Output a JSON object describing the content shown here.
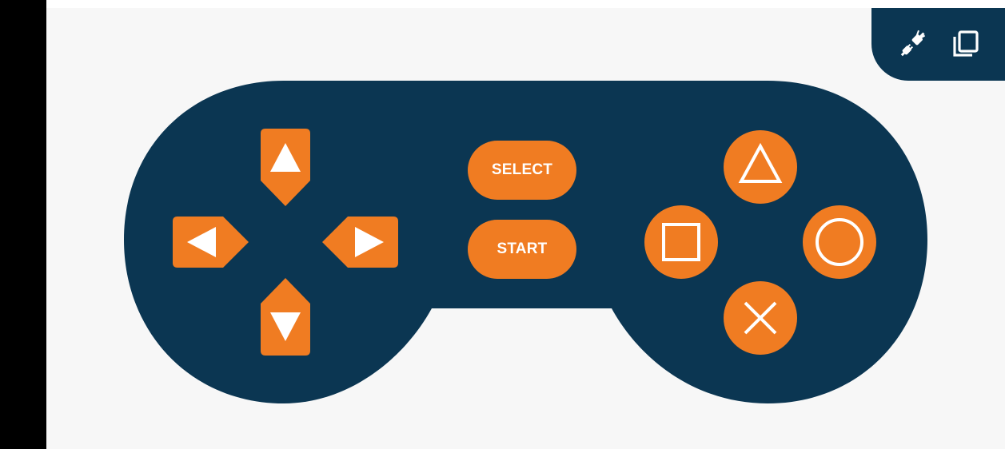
{
  "colors": {
    "background": "#f7f7f7",
    "controller_body": "#0b3652",
    "button_fill": "#f07c22",
    "button_glyph": "#ffffff",
    "left_bar": "#000000"
  },
  "tray": {
    "icons": [
      "plug-disconnected-icon",
      "window-stack-icon"
    ]
  },
  "dpad": {
    "up": "arrow-up-icon",
    "down": "arrow-down-icon",
    "left": "arrow-left-icon",
    "right": "arrow-right-icon"
  },
  "center_buttons": {
    "select_label": "SELECT",
    "start_label": "START"
  },
  "face_buttons": {
    "triangle": "triangle-icon",
    "square": "square-icon",
    "circle": "circle-icon",
    "cross": "cross-icon"
  }
}
